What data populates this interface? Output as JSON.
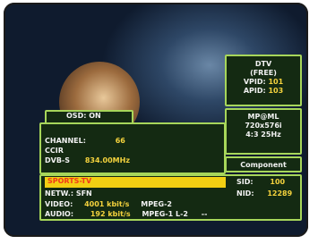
{
  "osd": {
    "label": "OSD: ON"
  },
  "dtv": {
    "title": "DTV",
    "type": "(FREE)",
    "vpid_label": "VPID:",
    "vpid_value": "101",
    "apid_label": "APID:",
    "apid_value": "103"
  },
  "video_format": {
    "profile": "MP@ML",
    "resolution": "720x576i",
    "aspect_rate": "4:3 25Hz"
  },
  "output": {
    "label": "Component"
  },
  "channel": {
    "label": "CHANNEL:",
    "value": "66",
    "standard": "CCIR",
    "system": "DVB-S",
    "frequency": "834.00MHz"
  },
  "service": {
    "name": "SPORTS-TV",
    "sid_label": "SID:",
    "sid_value": "100",
    "network": "NETW.: SFN",
    "nid_label": "NID:",
    "nid_value": "12289"
  },
  "streams": {
    "video_label": "VIDEO:",
    "video_rate": "4001 kbit/s",
    "video_codec": "MPEG-2",
    "audio_label": "AUDIO:",
    "audio_rate": "192 kbit/s",
    "audio_codec": "MPEG-1 L-2",
    "audio_extra": "--"
  },
  "colors": {
    "panel_border": "#a7d65a",
    "panel_bg": "#142a12",
    "value_yellow": "#f4d23d",
    "service_bar": "#f2cf12",
    "service_text": "#f13a1a"
  }
}
